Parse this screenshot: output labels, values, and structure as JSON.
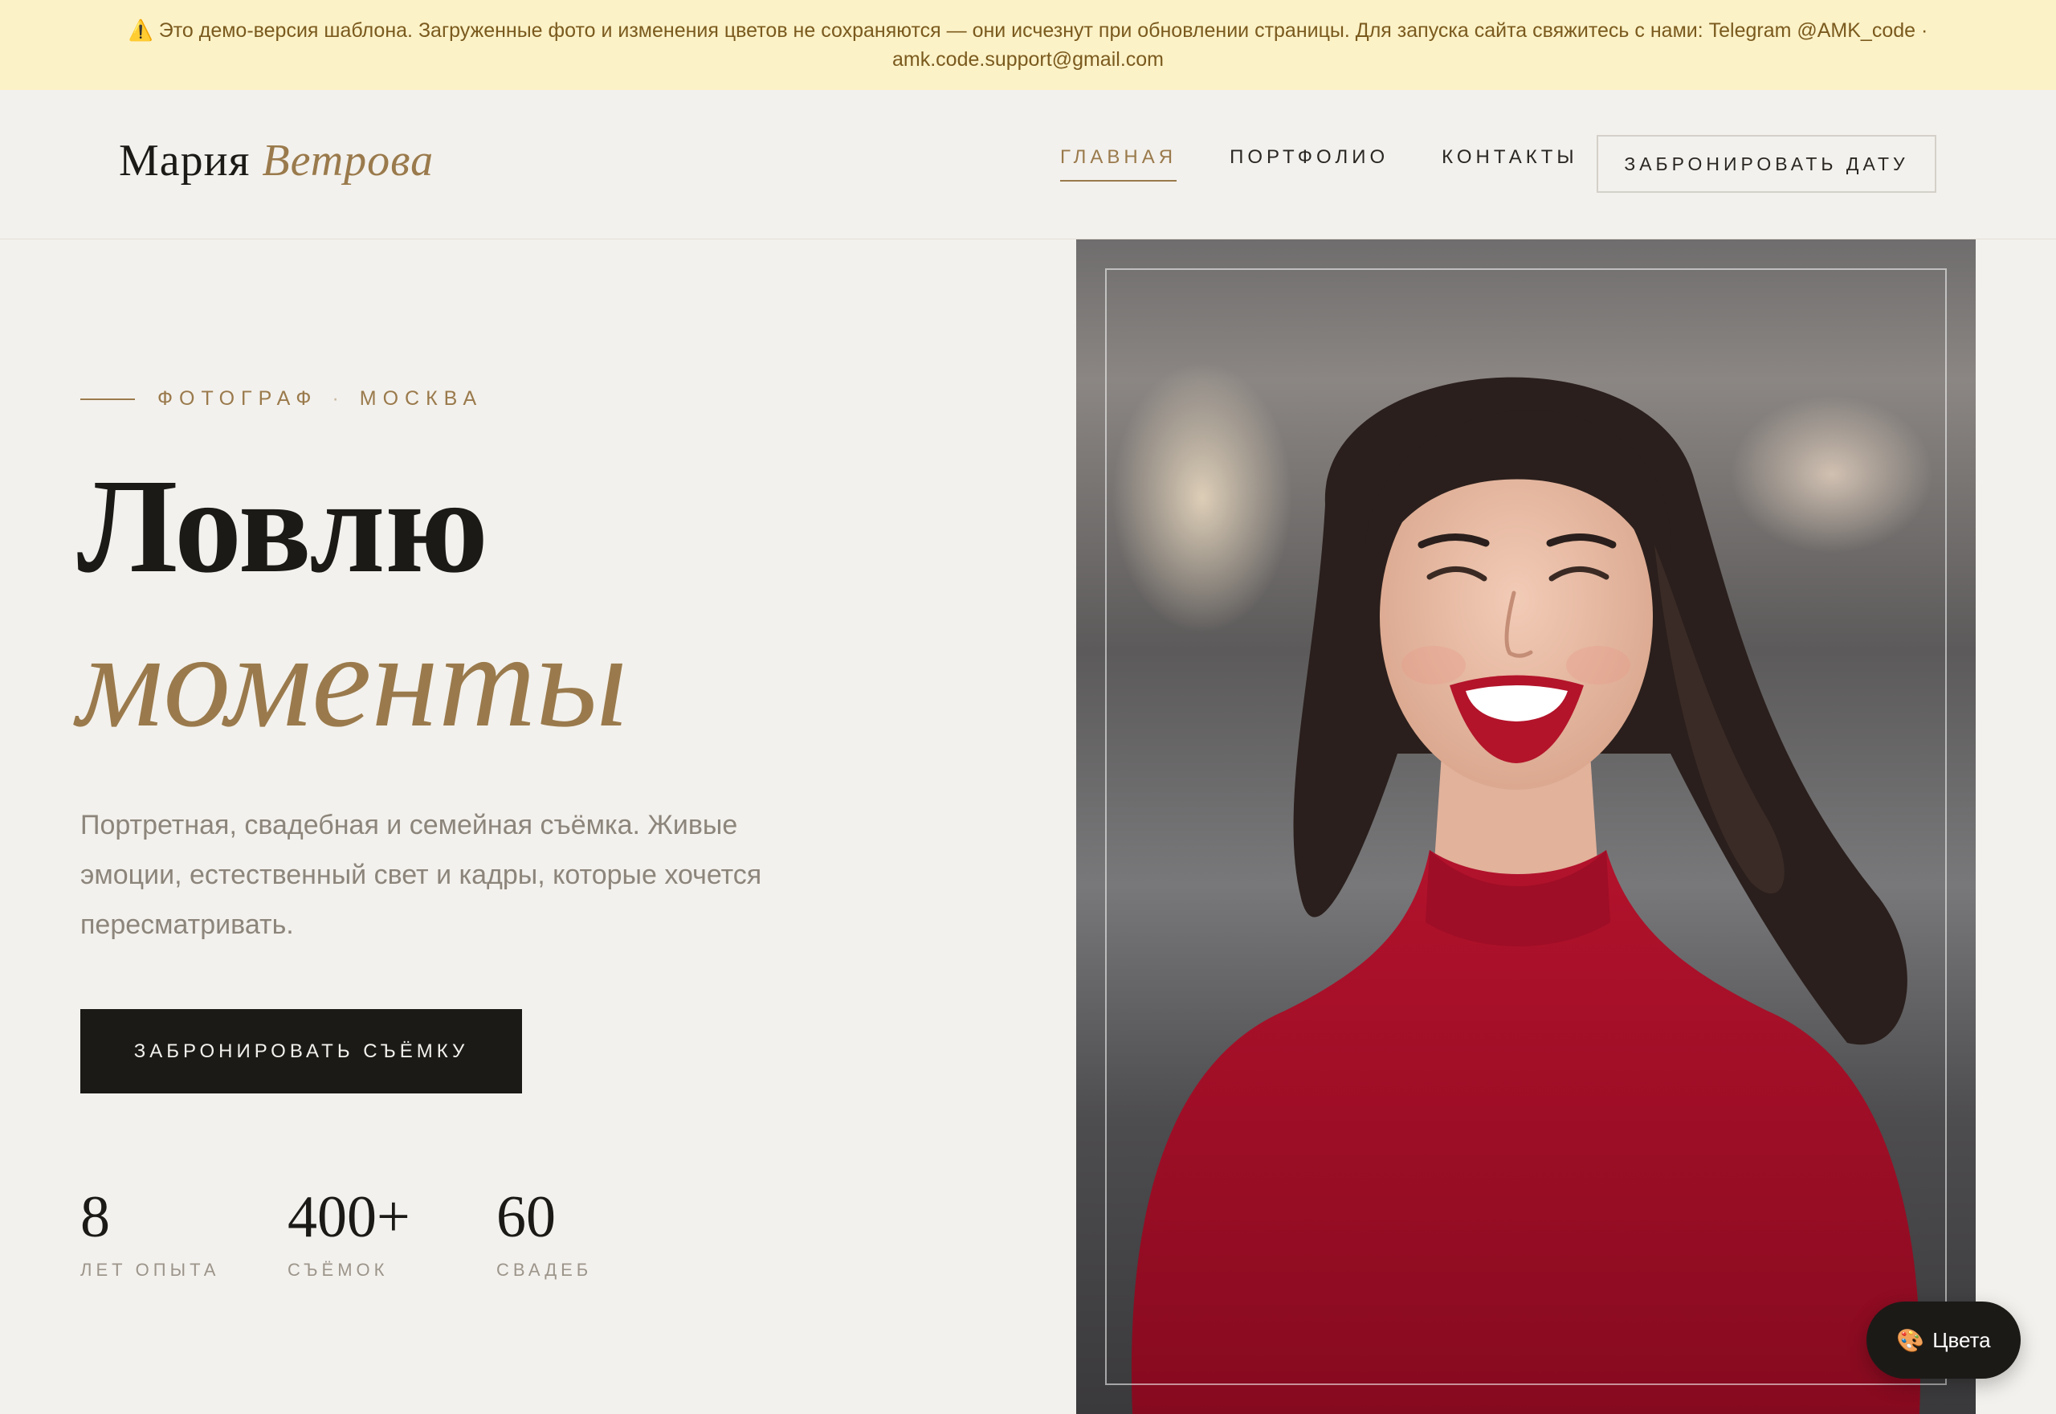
{
  "banner": {
    "icon": "warning-icon",
    "line1": "⚠️ Это демо-версия шаблона. Загруженные фото и изменения цветов не сохраняются — они исчезнут при обновлении страницы. Для запуска сайта свяжитесь с нами: Telegram @AMK_code ·",
    "line2": "amk.code.support@gmail.com"
  },
  "header": {
    "logo_first": "Мария",
    "logo_last": "Ветрова",
    "nav": [
      {
        "label": "ГЛАВНАЯ",
        "active": true
      },
      {
        "label": "ПОРТФОЛИО",
        "active": false
      },
      {
        "label": "КОНТАКТЫ",
        "active": false
      }
    ],
    "book_date_label": "ЗАБРОНИРОВАТЬ ДАТУ"
  },
  "hero": {
    "eyebrow_1": "ФОТОГРАФ",
    "eyebrow_sep": "·",
    "eyebrow_2": "МОСКВА",
    "title_line1": "Ловлю",
    "title_line2": "моменты",
    "lead": "Портретная, свадебная и семейная съёмка. Живые эмоции, естественный свет и кадры, которые хочется пересматривать.",
    "cta_label": "ЗАБРОНИРОВАТЬ СЪЁМКУ",
    "stats": [
      {
        "value": "8",
        "label": "ЛЕТ ОПЫТА"
      },
      {
        "value": "400+",
        "label": "СЪЁМОК"
      },
      {
        "value": "60",
        "label": "СВАДЕБ"
      }
    ]
  },
  "colors_button": {
    "icon": "palette-icon",
    "label": "Цвета"
  },
  "theme": {
    "background": "#f3f1ed",
    "accent": "#9a7a4c",
    "dark": "#1c1a17",
    "banner_bg": "#fcf2c7"
  }
}
